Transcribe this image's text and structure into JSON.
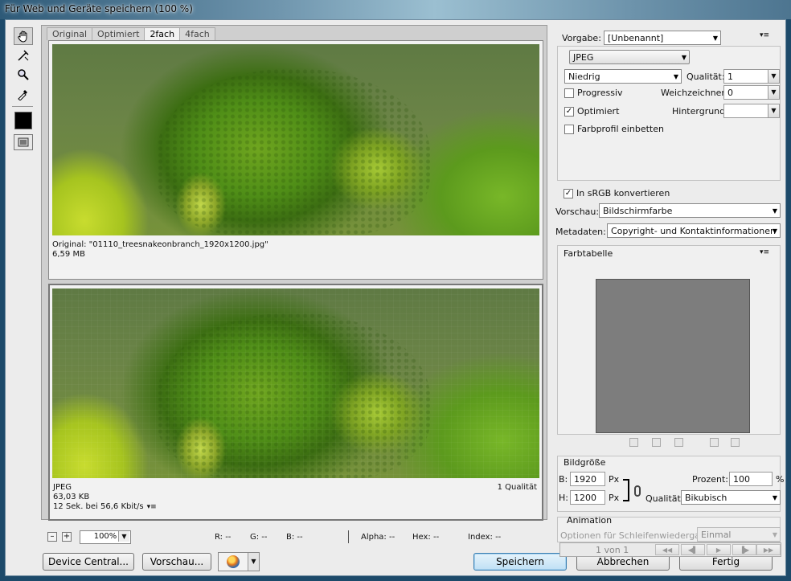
{
  "window": {
    "title": "Für Web und Geräte speichern (100 %)"
  },
  "tabs": [
    {
      "label": "Original",
      "active": false
    },
    {
      "label": "Optimiert",
      "active": false
    },
    {
      "label": "2fach",
      "active": true
    },
    {
      "label": "4fach",
      "active": false
    }
  ],
  "pane_original": {
    "line1": "Original: \"01110_treesnakeonbranch_1920x1200.jpg\"",
    "line2": "6,59 MB"
  },
  "pane_optimized": {
    "format": "JPEG",
    "size": "63,03 KB",
    "time": "12 Sek. bei 56,6 Kbit/s",
    "quality": "1 Qualität"
  },
  "status": {
    "zoom": "100%",
    "zoom_out": "–",
    "zoom_in": "+",
    "r": "R: --",
    "g": "G: --",
    "b": "B: --",
    "alpha": "Alpha: --",
    "hex": "Hex: --",
    "index": "Index: --"
  },
  "buttons": {
    "device_central": "Device Central...",
    "preview": "Vorschau...",
    "save": "Speichern",
    "cancel": "Abbrechen",
    "done": "Fertig"
  },
  "settings": {
    "preset_label": "Vorgabe:",
    "preset_value": "[Unbenannt]",
    "format": "JPEG",
    "quality_preset": "Niedrig",
    "quality_label": "Qualität:",
    "quality_value": "1",
    "progressive_label": "Progressiv",
    "progressive_checked": false,
    "blur_label": "Weichzeichnen:",
    "blur_value": "0",
    "optimized_label": "Optimiert",
    "optimized_checked": true,
    "matte_label": "Hintergrund:",
    "matte_value": "",
    "embed_profile_label": "Farbprofil einbetten",
    "embed_profile_checked": false,
    "srgb_label": "In sRGB konvertieren",
    "srgb_checked": true,
    "preview_label": "Vorschau:",
    "preview_value": "Bildschirmfarbe",
    "metadata_label": "Metadaten:",
    "metadata_value": "Copyright- und Kontaktinformationen"
  },
  "color_table": {
    "title": "Farbtabelle",
    "color": "#7d7d7d"
  },
  "image_size": {
    "title": "Bildgröße",
    "w_label": "B:",
    "w_value": "1920",
    "h_label": "H:",
    "h_value": "1200",
    "unit": "Px",
    "percent_label": "Prozent:",
    "percent_value": "100",
    "percent_unit": "%",
    "quality_label": "Qualität:",
    "quality_value": "Bikubisch"
  },
  "animation": {
    "title": "Animation",
    "loop_label": "Optionen für Schleifenwiedergabe:",
    "loop_value": "Einmal",
    "frame": "1 von 1"
  },
  "glyphs": {
    "check": "✓",
    "dropdown": "▼",
    "flyout": "▾≡",
    "first": "◀◀",
    "prev": "◀▌",
    "play": "▶",
    "next": "▐▶",
    "last": "▶▶"
  }
}
